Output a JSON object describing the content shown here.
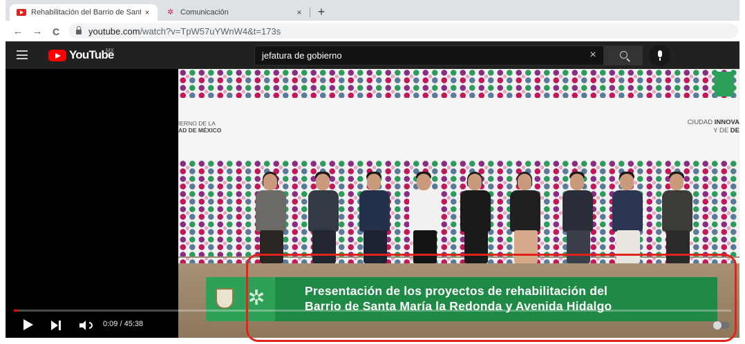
{
  "browser": {
    "tabs": [
      {
        "title": "Rehabilitación del Barrio de Santa",
        "close": "×",
        "favicon": "youtube-icon",
        "active": true
      },
      {
        "title": "Comunicación",
        "close": "×",
        "favicon": "cdmx-icon",
        "active": false
      }
    ],
    "new_tab": "+",
    "nav": {
      "back": "←",
      "forward": "→",
      "reload": "C"
    },
    "url_host": "youtube.com",
    "url_path": "/watch?v=TpW57uYWnW4&t=173s"
  },
  "youtube": {
    "logo_text": "YouTube",
    "country": "MX",
    "search_query": "jefatura de gobierno",
    "clear": "×"
  },
  "video": {
    "backdrop_left": [
      "IERNO DE LA",
      "AD DE MÉXICO"
    ],
    "backdrop_right": [
      "CIUDAD ",
      "INNOVA",
      "Y DE ",
      "DE"
    ],
    "lower_third": [
      "Presentación de los proyectos de rehabilitación del",
      "Barrio de Santa María la Redonda y Avenida Hidalgo"
    ],
    "current_time": "0:09",
    "duration": "45:38",
    "progress_fraction": 0.0033,
    "time_separator": " / "
  },
  "colors": {
    "youtube_red": "#ff0000",
    "lower_third_green": "#1f8a46",
    "annotation_red": "#e2231a"
  }
}
